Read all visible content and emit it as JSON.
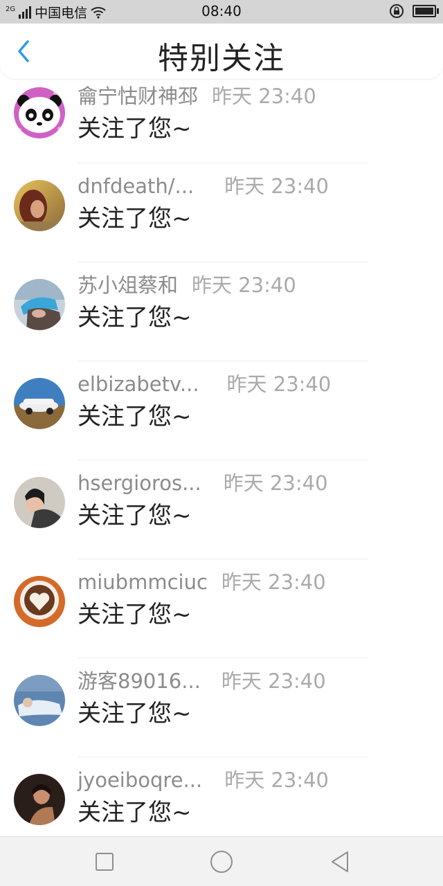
{
  "status_bar": {
    "network_tag": "2G",
    "carrier": "中国电信",
    "time": "08:40",
    "icons": [
      "signal-icon",
      "wifi-icon",
      "rotation-lock-icon",
      "battery-icon"
    ]
  },
  "header": {
    "title": "特别关注",
    "back_icon": "chevron-left-icon",
    "accent_color": "#2b9ce6"
  },
  "notifications": [
    {
      "name": "龠宁怙财神邳",
      "time": "昨天 23:40",
      "message": "关注了您~",
      "avatar": "panda"
    },
    {
      "name": "dnfdeath/...",
      "time": "昨天 23:40",
      "message": "关注了您~",
      "avatar": "photo-warm"
    },
    {
      "name": "苏小俎蔡和",
      "time": "昨天 23:40",
      "message": "关注了您~",
      "avatar": "photo-pool"
    },
    {
      "name": "elbizabetv...",
      "time": "昨天 23:40",
      "message": "关注了您~",
      "avatar": "photo-car"
    },
    {
      "name": "hsergioros...",
      "time": "昨天 23:40",
      "message": "关注了您~",
      "avatar": "photo-portrait"
    },
    {
      "name": "miubmmciuc",
      "time": "昨天 23:40",
      "message": "关注了您~",
      "avatar": "latte-art"
    },
    {
      "name": "游客89016...",
      "time": "昨天 23:40",
      "message": "关注了您~",
      "avatar": "photo-blue"
    },
    {
      "name": "jyoeiboqre...",
      "time": "昨天 23:40",
      "message": "关注了您~",
      "avatar": "photo-dark"
    }
  ],
  "nav_bar": {
    "buttons": [
      "recent-apps-icon",
      "home-icon",
      "back-triangle-icon"
    ]
  }
}
